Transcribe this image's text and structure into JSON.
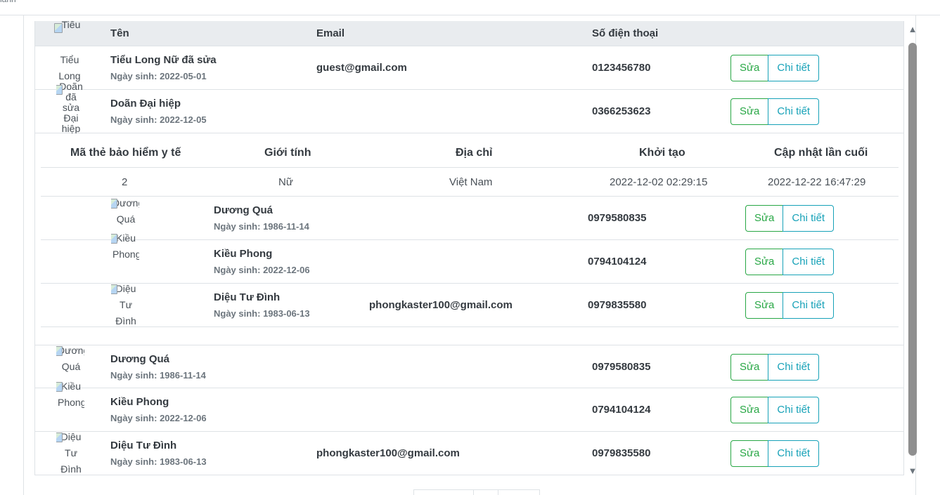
{
  "top_strip": {
    "cut_text": "lanh"
  },
  "table": {
    "headers": {
      "avatar_alt": "Tiểu",
      "name": "Tên",
      "email": "Email",
      "phone": "Số điện thoại"
    },
    "rows": [
      {
        "avatar_alt": "Tiểu Long Nữ",
        "name": "Tiểu Long Nữ đã sửa",
        "dob": "Ngày sinh: 2022-05-01",
        "email": "guest@gmail.com",
        "phone": "0123456780"
      },
      {
        "avatar_alt": "Doãn đã sửa Đại hiệp",
        "name": "Doãn Đại hiệp",
        "dob": "Ngày sinh: 2022-12-05",
        "email": "",
        "phone": "0366253623"
      },
      {
        "avatar_alt": "Dương Quá",
        "name": "Dương Quá",
        "dob": "Ngày sinh: 1986-11-14",
        "email": "",
        "phone": "0979580835"
      },
      {
        "avatar_alt": "Kiều Phong",
        "name": "Kiều Phong",
        "dob": "Ngày sinh: 2022-12-06",
        "email": "",
        "phone": "0794104124"
      },
      {
        "avatar_alt": "Diệu Tư Đình",
        "name": "Diệu Tư Đình",
        "dob": "Ngày sinh: 1983-06-13",
        "email": "phongkaster100@gmail.com",
        "phone": "0979835580"
      }
    ],
    "actions": {
      "edit": "Sửa",
      "detail": "Chi tiết"
    }
  },
  "detail": {
    "headers": {
      "insurance": "Mã thẻ bảo hiểm y tế",
      "gender": "Giới tính",
      "address": "Địa chỉ",
      "created": "Khởi tạo",
      "updated": "Cập nhật lần cuối"
    },
    "values": {
      "insurance": "2",
      "gender": "Nữ",
      "address": "Việt Nam",
      "created": "2022-12-02 02:29:15",
      "updated": "2022-12-22 16:47:29"
    },
    "subrows": [
      {
        "avatar_alt": "Dương Quá",
        "name": "Dương Quá",
        "dob": "Ngày sinh: 1986-11-14",
        "email": "",
        "phone": "0979580835"
      },
      {
        "avatar_alt": "Kiều Phong",
        "name": "Kiều Phong",
        "dob": "Ngày sinh: 2022-12-06",
        "email": "",
        "phone": "0794104124"
      },
      {
        "avatar_alt": "Diệu Tư Đình",
        "name": "Diệu Tư Đình",
        "dob": "Ngày sinh: 1983-06-13",
        "email": "phongkaster100@gmail.com",
        "phone": "0979835580"
      }
    ]
  },
  "scrollbar": {
    "up_icon": "scroll-up-arrow-icon",
    "down_icon": "scroll-down-arrow-icon"
  }
}
